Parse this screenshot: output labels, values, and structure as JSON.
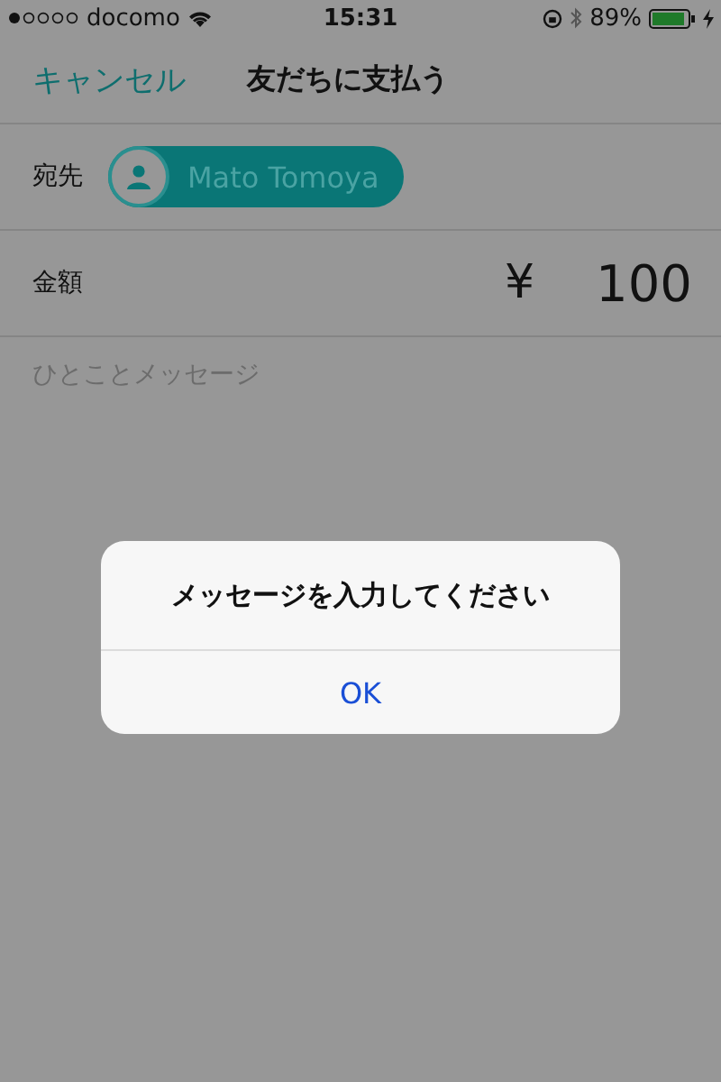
{
  "status_bar": {
    "carrier": "docomo",
    "time": "15:31",
    "battery": "89%"
  },
  "nav": {
    "cancel": "キャンセル",
    "title": "友だちに支払う"
  },
  "recipient": {
    "label": "宛先",
    "name": "Mato Tomoya"
  },
  "amount": {
    "label": "金額",
    "currency": "¥",
    "value": "100"
  },
  "message": {
    "placeholder": "ひとことメッセージ"
  },
  "alert": {
    "message": "メッセージを入力してください",
    "buttons": [
      "OK"
    ]
  }
}
